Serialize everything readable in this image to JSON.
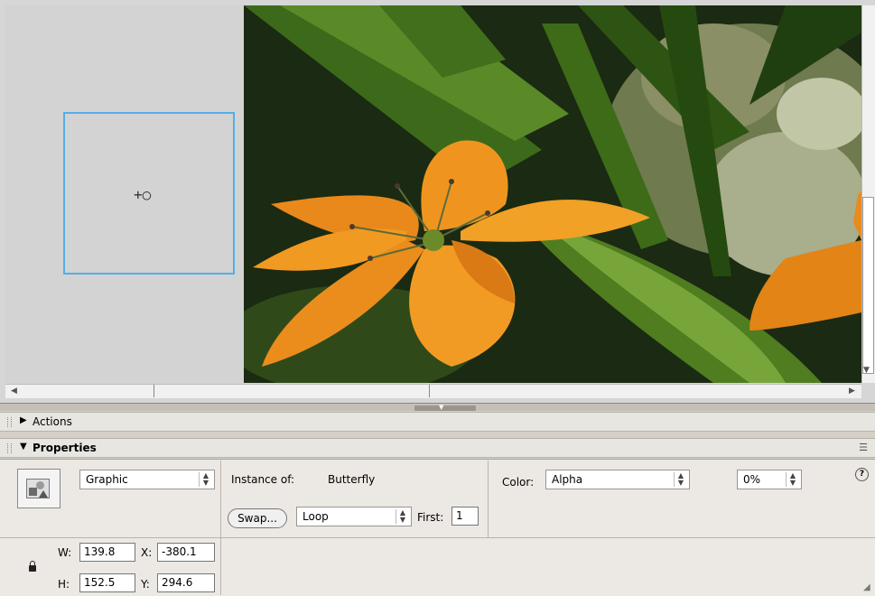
{
  "stage": {
    "photo_alt": "Orange lily flower with green leaves"
  },
  "panels": {
    "actions_title": "Actions",
    "properties_title": "Properties"
  },
  "properties": {
    "symbol_type": "Graphic",
    "instance_label": "Instance of:",
    "instance_name": "Butterfly",
    "swap_label": "Swap...",
    "loop_mode": "Loop",
    "first_label": "First:",
    "first_value": "1",
    "color_label": "Color:",
    "color_mode": "Alpha",
    "alpha_value": "0%",
    "w_label": "W:",
    "w_value": "139.8",
    "h_label": "H:",
    "h_value": "152.5",
    "x_label": "X:",
    "x_value": "-380.1",
    "y_label": "Y:",
    "y_value": "294.6"
  },
  "icons": {
    "actions_arrow": "▶",
    "properties_arrow": "▼",
    "help": "?",
    "reg_point": "+○"
  },
  "colors": {
    "selection": "#55aee6",
    "petal": "#e98a1e",
    "leaf": "#4f7d1f"
  }
}
